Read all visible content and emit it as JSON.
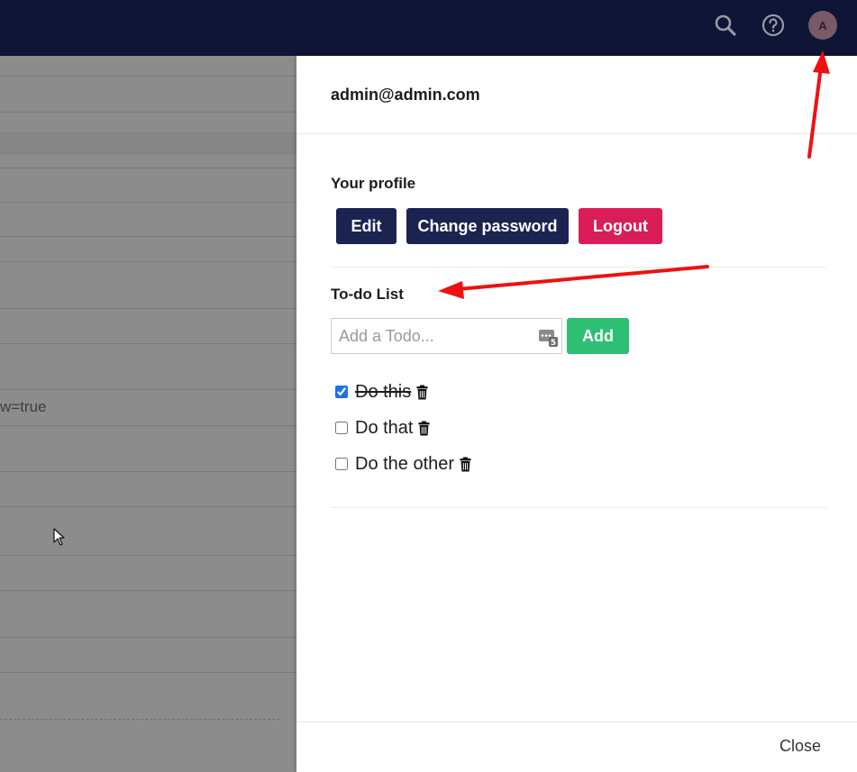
{
  "topbar": {
    "icons": [
      "search-icon",
      "help-icon"
    ],
    "avatar_initial": "A"
  },
  "background": {
    "partial_text": "w=true"
  },
  "drawer": {
    "user_email": "admin@admin.com",
    "profile": {
      "title": "Your profile",
      "edit_label": "Edit",
      "change_password_label": "Change password",
      "logout_label": "Logout"
    },
    "todo": {
      "title": "To-do List",
      "placeholder": "Add a Todo...",
      "input_value": "",
      "add_label": "Add",
      "items": [
        {
          "text": "Do this",
          "done": true
        },
        {
          "text": "Do that",
          "done": false
        },
        {
          "text": "Do the other",
          "done": false
        }
      ]
    },
    "close_label": "Close"
  },
  "colors": {
    "navbar": "#0e1537",
    "primary_button": "#1b2451",
    "logout_button": "#d91d57",
    "add_button": "#2ebf75",
    "annotation_arrow": "#ee1111"
  }
}
